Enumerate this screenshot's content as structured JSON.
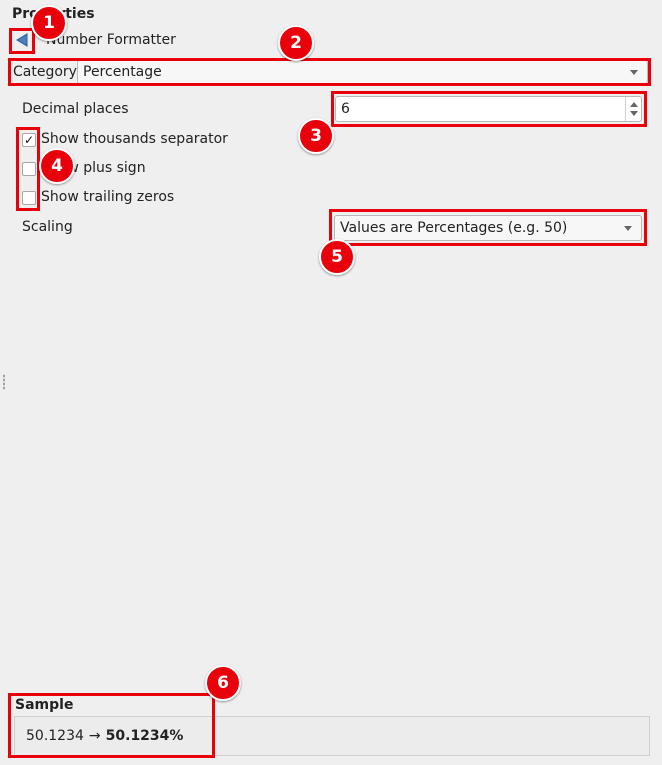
{
  "panel": {
    "title": "Properties",
    "formatter_title": "Number Formatter"
  },
  "category": {
    "label": "Category",
    "value": "Percentage"
  },
  "decimal_places": {
    "label": "Decimal places",
    "value": "6"
  },
  "checkboxes": [
    {
      "label": "Show thousands separator",
      "checked": true
    },
    {
      "label": "Show plus sign",
      "checked": false
    },
    {
      "label": "Show trailing zeros",
      "checked": false
    }
  ],
  "scaling": {
    "label": "Scaling",
    "value": "Values are Percentages (e.g. 50)"
  },
  "sample": {
    "label": "Sample",
    "input": "50.1234",
    "arrow": "→",
    "output": "50.1234%"
  },
  "annotations": [
    "1",
    "2",
    "3",
    "4",
    "5",
    "6"
  ],
  "colors": {
    "annotation": "#e8000b",
    "back_arrow": "#4a7fbf"
  },
  "icons": {
    "back": "left-triangle-arrow-icon",
    "dropdown": "chevron-down-icon",
    "spin_up": "spin-up-icon",
    "spin_down": "spin-down-icon",
    "check": "checkmark-icon"
  }
}
